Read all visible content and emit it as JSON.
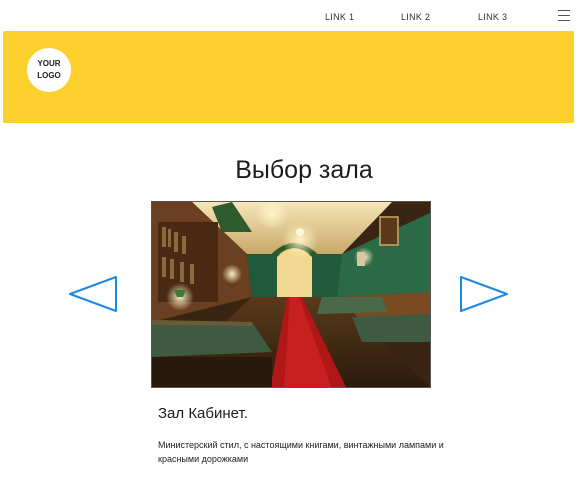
{
  "nav": {
    "links": [
      "LINK 1",
      "LINK 2",
      "LINK 3"
    ],
    "menu_icon": "hamburger-icon"
  },
  "header": {
    "logo_text": "YOUR LOGO",
    "banner_color": "#fdd02e"
  },
  "main": {
    "title": "Выбор зала",
    "hall": {
      "name": "Зал Кабинет.",
      "description": "Министерский стил, с настоящими книгами, винтажными лампами и красными дорожками"
    },
    "prev_icon": "triangle-left-icon",
    "next_icon": "triangle-right-icon",
    "arrow_color": "#1e88e5"
  }
}
